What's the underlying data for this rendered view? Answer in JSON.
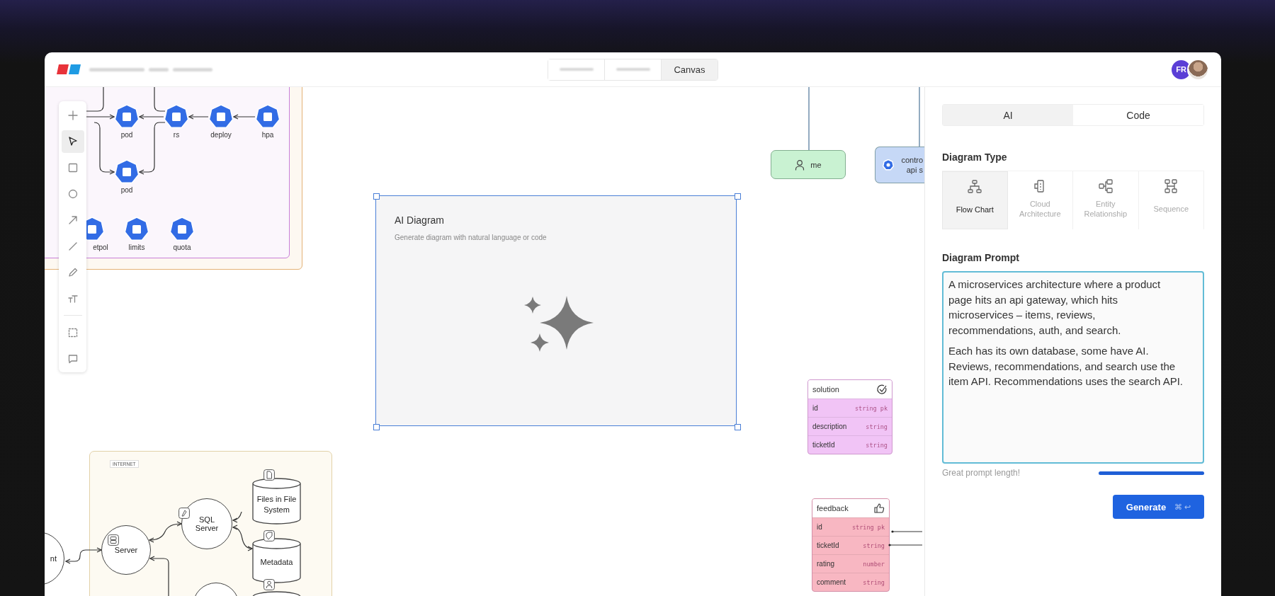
{
  "header": {
    "view_tabs": [
      {
        "kind": "blurred",
        "selected": false
      },
      {
        "kind": "blurred",
        "selected": false
      },
      {
        "kind": "text",
        "label": "Canvas",
        "selected": true
      }
    ],
    "avatars": [
      {
        "kind": "initials",
        "initials": "FR"
      },
      {
        "kind": "photo"
      }
    ]
  },
  "toolbar": {
    "tools": [
      {
        "kind": "add",
        "selected": false
      },
      {
        "kind": "select",
        "selected": true
      },
      {
        "kind": "rectangle",
        "selected": false
      },
      {
        "kind": "ellipse",
        "selected": false
      },
      {
        "kind": "arrow",
        "selected": false
      },
      {
        "kind": "line",
        "selected": false
      },
      {
        "kind": "pen",
        "selected": false
      },
      {
        "kind": "text",
        "selected": false
      },
      {
        "kind": "frame",
        "selected": false
      },
      {
        "kind": "comment",
        "selected": false
      }
    ]
  },
  "canvas": {
    "cluster": {
      "nodes": [
        {
          "label": "pod"
        },
        {
          "label": "rs"
        },
        {
          "label": "deploy"
        },
        {
          "label": "hpa"
        },
        {
          "label": "pod"
        },
        {
          "label": "etpol"
        },
        {
          "label": "limits"
        },
        {
          "label": "quota"
        }
      ]
    },
    "ai_diagram": {
      "title": "AI Diagram",
      "subtitle": "Generate diagram with natural language or code",
      "selected": true
    },
    "nodes": [
      {
        "kind": "person",
        "lines": [
          "me"
        ],
        "color": "#c9f2d2"
      },
      {
        "kind": "service",
        "lines": [
          "contro",
          "api s"
        ],
        "color": "#c6d8f6"
      }
    ],
    "entities": [
      {
        "name": "solution",
        "color": "#f1c4f6",
        "fields": [
          {
            "name": "id",
            "type": "string pk"
          },
          {
            "name": "description",
            "type": "string"
          },
          {
            "name": "ticketId",
            "type": "string"
          }
        ]
      },
      {
        "name": "feedback",
        "color": "#f8b7c2",
        "fields": [
          {
            "name": "id",
            "type": "string pk"
          },
          {
            "name": "ticketId",
            "type": "string"
          },
          {
            "name": "rating",
            "type": "number"
          },
          {
            "name": "comment",
            "type": "string"
          }
        ]
      }
    ],
    "internet": {
      "label": "INTERNET",
      "nodes": [
        {
          "kind": "circle",
          "label": "nt"
        },
        {
          "kind": "circle",
          "label": "Server"
        },
        {
          "kind": "circle",
          "label": "SQL Server"
        },
        {
          "kind": "cylinder",
          "label": "Files in File System"
        },
        {
          "kind": "cylinder",
          "label": "Metadata"
        },
        {
          "kind": "circle"
        },
        {
          "kind": "cylinder"
        }
      ]
    }
  },
  "panel": {
    "mode_tabs": [
      {
        "label": "AI",
        "selected": true
      },
      {
        "label": "Code",
        "selected": false
      }
    ],
    "diagram_type": {
      "heading": "Diagram Type",
      "options": [
        {
          "label": "Flow Chart",
          "selected": true
        },
        {
          "label": "Cloud Architecture",
          "selected": false
        },
        {
          "label": "Entity Relationship",
          "selected": false
        },
        {
          "label": "Sequence",
          "selected": false
        }
      ]
    },
    "prompt": {
      "heading": "Diagram Prompt",
      "paragraphs": [
        "A microservices architecture where a product page hits an api gateway, which hits microservices – items, reviews, recommendations, auth, and search.",
        "Each has its own database, some have AI. Reviews, recommendations, and search use the item API. Recommendations uses the search API."
      ],
      "hint": "Great prompt length!",
      "level": 1
    },
    "generate": {
      "label": "Generate",
      "shortcut": "⌘ ↩"
    }
  }
}
